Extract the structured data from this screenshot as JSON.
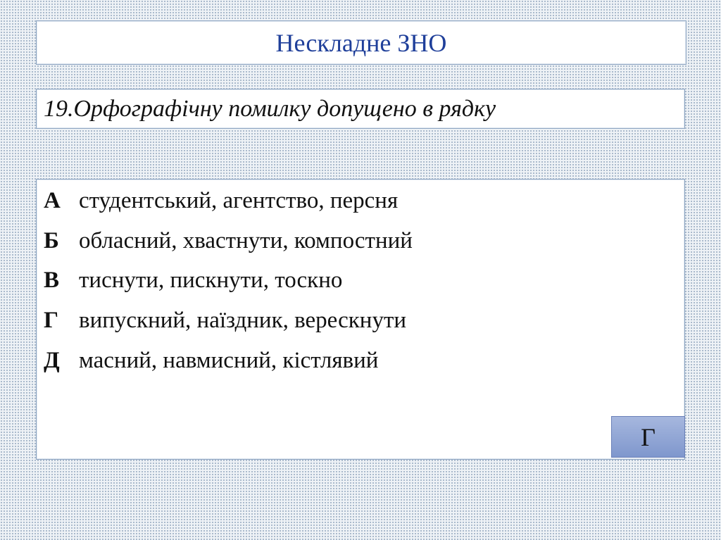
{
  "header": {
    "title": "Нескладне ЗНО"
  },
  "question": {
    "text": "19.Орфографічну помилку допущено в рядку"
  },
  "options": [
    {
      "letter": "А",
      "text": "студентський, агентство, персня"
    },
    {
      "letter": "Б",
      "text": "обласний, хвастнути, компостний"
    },
    {
      "letter": "В",
      "text": "тиснути, пискнути, тоскно"
    },
    {
      "letter": "Г",
      "text": "випускний, наїздник, верескнути"
    },
    {
      "letter": "Д",
      "text": "масний, навмисний, кістлявий"
    }
  ],
  "answer": {
    "label": "Г"
  },
  "colors": {
    "title": "#1f3f9a",
    "panel_border": "#8fa6c2",
    "answer_button": "#8ea3d6"
  }
}
